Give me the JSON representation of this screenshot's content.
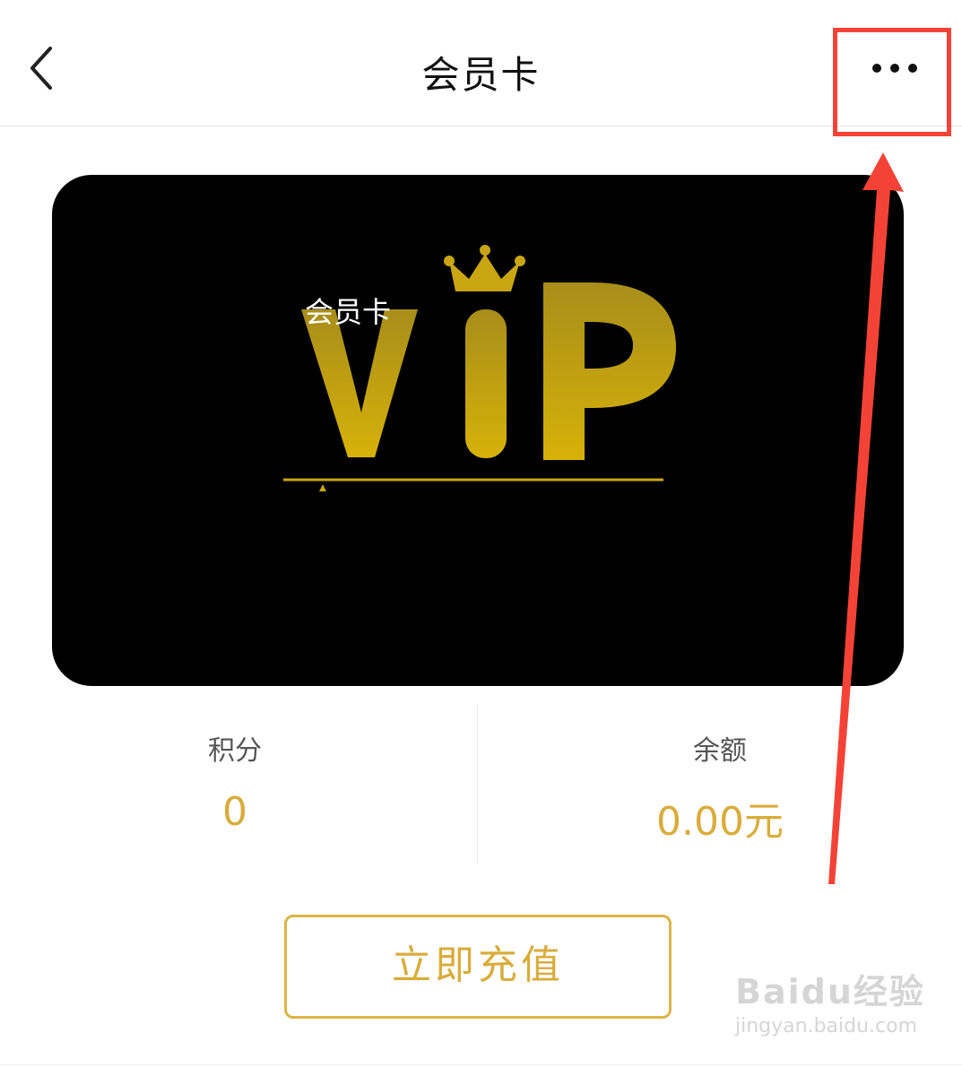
{
  "header": {
    "title": "会员卡",
    "back_icon": "chevron-left-icon",
    "more_icon": "more-horizontal-icon"
  },
  "card": {
    "name": "会员卡",
    "logo_text": "VIP",
    "background": "#000000",
    "gold": "#c9a511"
  },
  "stats": {
    "points": {
      "label": "积分",
      "value": "0"
    },
    "balance": {
      "label": "余额",
      "value": "0.00元"
    }
  },
  "actions": {
    "recharge_label": "立即充值"
  },
  "annotation": {
    "color": "#f44336"
  },
  "watermark": {
    "main": "Baidu经验",
    "sub": "jingyan.baidu.com"
  },
  "colors": {
    "accent": "#d9ad3b",
    "text": "#111111"
  }
}
